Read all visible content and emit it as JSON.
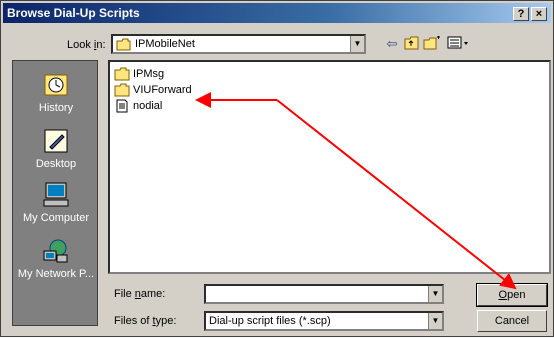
{
  "window": {
    "title": "Browse Dial-Up Scripts",
    "help_button": "?",
    "close_button": "×"
  },
  "lookin": {
    "label_pre": "Look ",
    "label_ul": "i",
    "label_post": "n:",
    "value": "IPMobileNet"
  },
  "places": [
    {
      "label": "History",
      "icon": "history-icon"
    },
    {
      "label": "Desktop",
      "icon": "desktop-icon"
    },
    {
      "label": "My Computer",
      "icon": "my-computer-icon"
    },
    {
      "label": "My Network P...",
      "icon": "my-network-icon"
    }
  ],
  "files": [
    {
      "name": "IPMsg",
      "icon": "folder-icon"
    },
    {
      "name": "VIUForward",
      "icon": "folder-icon"
    },
    {
      "name": "nodial",
      "icon": "script-file-icon"
    }
  ],
  "filename": {
    "label_pre": "File ",
    "label_ul": "n",
    "label_post": "ame:",
    "value": ""
  },
  "filetype": {
    "label_pre": "Files of ",
    "label_ul": "t",
    "label_post": "ype:",
    "value": "Dial-up script files (*.scp)"
  },
  "buttons": {
    "open_ul": "O",
    "open_rest": "pen",
    "cancel": "Cancel"
  },
  "colors": {
    "title_bar": "#0a246a",
    "dialog_face": "#d4d0c8",
    "places_bar": "#808080",
    "annotation_arrow": "#ff0000"
  }
}
